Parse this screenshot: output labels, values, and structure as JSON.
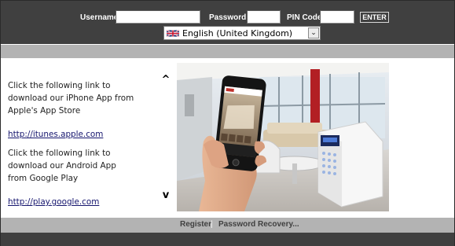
{
  "login": {
    "username_label": "Username:",
    "username_value": "",
    "password_label": "Password:",
    "password_value": "",
    "pin_label": "PIN Code:",
    "pin_value": "",
    "enter_label": "ENTER"
  },
  "language": {
    "selected": "English (United Kingdom)",
    "flag_icon": "uk-flag-icon"
  },
  "content": {
    "iphone_text": [
      "Click the following link to",
      "download our iPhone App from",
      "Apple's App Store"
    ],
    "iphone_link": "http://itunes.apple.com",
    "android_text": [
      "Click the following link to",
      "download our Android App",
      "from Google Play"
    ],
    "android_link": "http://play.google.com",
    "scroll_up": "^",
    "scroll_down": "v"
  },
  "footer": {
    "register_label": "Register",
    "separator": "|",
    "recovery_label": "Password Recovery..."
  },
  "colors": {
    "bar": "#404040",
    "band": "#b3b3b3",
    "link": "#15156e"
  }
}
